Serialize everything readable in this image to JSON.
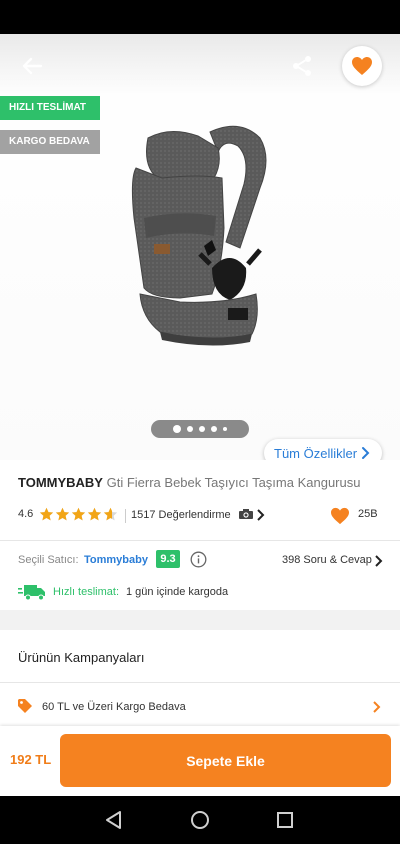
{
  "header": {
    "back_icon": "arrow-left-icon",
    "share_icon": "share-icon",
    "favorite_icon": "heart-icon"
  },
  "badges": {
    "fast_delivery": "HIZLI TESLİMAT",
    "free_cargo": "KARGO BEDAVA"
  },
  "gallery": {
    "page_count": 5,
    "active_index": 0
  },
  "features_button": "Tüm Özellikler",
  "product": {
    "brand": "TOMMYBABY",
    "name": "Gti Fierra Bebek Taşıyıcı Taşıma Kangurusu",
    "rating": "4.6",
    "rating_value": 4.6,
    "reviews": "1517 Değerlendirme",
    "likes": "25B"
  },
  "seller": {
    "label": "Seçili Satıcı:",
    "name": "Tommybaby",
    "score": "9.3",
    "qa": "398 Soru & Cevap"
  },
  "delivery": {
    "label": "Hızlı teslimat:",
    "text": "1 gün içinde kargoda"
  },
  "campaigns": {
    "title": "Ürünün Kampanyaları",
    "items": [
      {
        "text": "60 TL ve Üzeri Kargo Bedava"
      }
    ]
  },
  "bottom": {
    "price": "192 TL",
    "add_to_cart": "Sepete Ekle"
  },
  "colors": {
    "accent_orange": "#f58220",
    "green": "#2ec06a",
    "link_blue": "#2a7dd7"
  }
}
